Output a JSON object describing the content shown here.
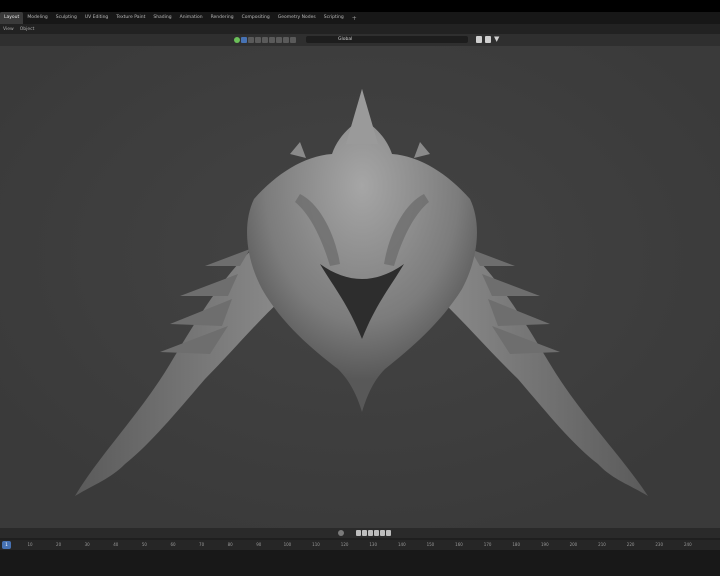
{
  "workspace_tabs": [
    {
      "label": "Layout",
      "active": true
    },
    {
      "label": "Modeling"
    },
    {
      "label": "Sculpting"
    },
    {
      "label": "UV Editing"
    },
    {
      "label": "Texture Paint"
    },
    {
      "label": "Shading"
    },
    {
      "label": "Animation"
    },
    {
      "label": "Rendering"
    },
    {
      "label": "Compositing"
    },
    {
      "label": "Geometry Nodes"
    },
    {
      "label": "Scripting"
    }
  ],
  "add_tab_label": "+",
  "menu": {
    "view": "View",
    "object": "Object"
  },
  "viewport_header": {
    "transform_orientation": "Global"
  },
  "timeline": {
    "current_frame": "1",
    "ruler_ticks": [
      "10",
      "20",
      "30",
      "40",
      "50",
      "60",
      "70",
      "80",
      "90",
      "100",
      "110",
      "120",
      "130",
      "140",
      "150",
      "160",
      "170",
      "180",
      "190",
      "200",
      "210",
      "220",
      "230",
      "240"
    ]
  },
  "colors": {
    "accent": "#4772b3",
    "viewport_bg": "#3d3d3d",
    "header_bg": "#2f2f2f"
  },
  "icons": [
    "filter-icon",
    "snap-icon",
    "overlay-icon",
    "keyframe-icon",
    "play-icon"
  ]
}
